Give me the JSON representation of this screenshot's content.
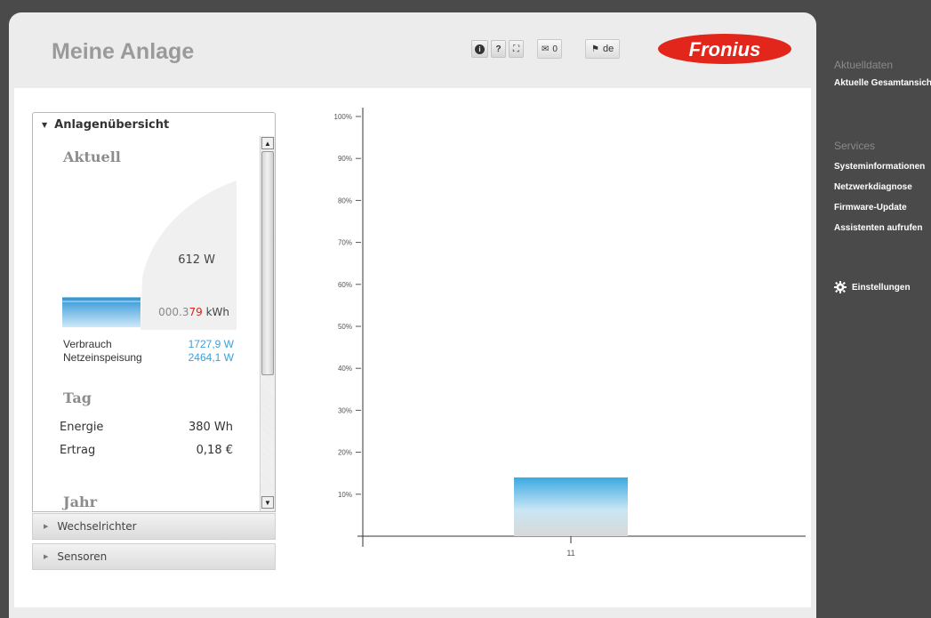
{
  "header": {
    "title": "Meine Anlage",
    "toolbar": {
      "info_label": "i",
      "help_label": "?",
      "fullscreen_label": "⛶",
      "messages_count": "0",
      "language": "de"
    },
    "logo_text": "Fronius",
    "logo_color": "#e2261b"
  },
  "left_panel": {
    "accordion_title": "Anlagenübersicht",
    "current": {
      "title": "Aktuell",
      "power": "612 W",
      "energy_digits": "000.3",
      "energy_red": "79",
      "energy_unit": "kWh",
      "consumption_label": "Verbrauch",
      "consumption_value": "1727,9 W",
      "feed_in_label": "Netzeinspeisung",
      "feed_in_value": "2464,1 W",
      "fill_fraction": 0.2
    },
    "day": {
      "title": "Tag",
      "energy_label": "Energie",
      "energy_value": "380 Wh",
      "yield_label": "Ertrag",
      "yield_value": "0,18 €"
    },
    "year": {
      "title": "Jahr"
    },
    "collapsed": [
      {
        "label": "Wechselrichter"
      },
      {
        "label": "Sensoren"
      }
    ]
  },
  "chart_data": {
    "type": "bar",
    "categories": [
      "11"
    ],
    "values": [
      14
    ],
    "yticks": [
      "100%",
      "90%",
      "80%",
      "70%",
      "60%",
      "50%",
      "40%",
      "30%",
      "20%",
      "10%"
    ],
    "ylim": [
      0,
      100
    ],
    "colors": {
      "top": "#3aa9e0",
      "bottom": "#d8d8d8"
    },
    "grid": false
  },
  "sidebar": {
    "section1_title": "Aktuelldaten",
    "section1_items": [
      "Aktuelle Gesamtansicht"
    ],
    "section2_title": "Services",
    "section2_items": [
      "Systeminformationen",
      "Netzwerkdiagnose",
      "Firmware-Update",
      "Assistenten aufrufen"
    ],
    "settings_label": "Einstellungen"
  }
}
